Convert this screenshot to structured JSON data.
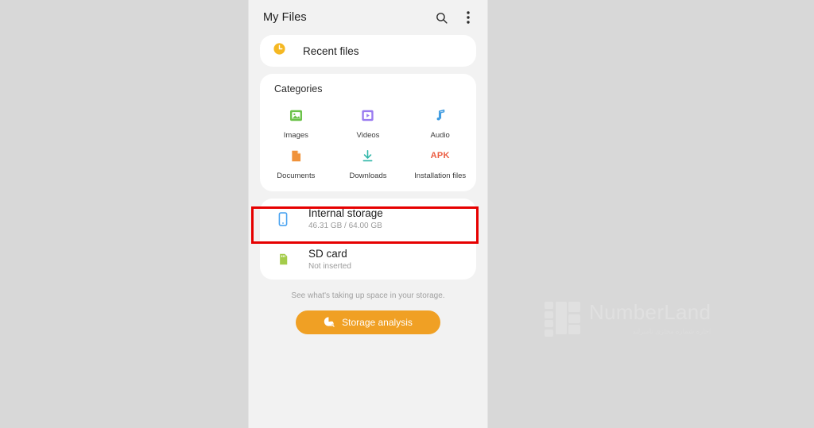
{
  "appbar": {
    "title": "My Files",
    "search_icon": "search-icon",
    "overflow_icon": "more-vertical-icon"
  },
  "recent": {
    "label": "Recent files",
    "icon": "clock-icon",
    "icon_color": "#f5b823"
  },
  "categories": {
    "title": "Categories",
    "items": [
      {
        "label": "Images",
        "icon": "image-icon",
        "color": "#6cc24a"
      },
      {
        "label": "Videos",
        "icon": "video-play-icon",
        "color": "#9a7bf0"
      },
      {
        "label": "Audio",
        "icon": "music-note-icon",
        "color": "#3d9ae0"
      },
      {
        "label": "Documents",
        "icon": "document-icon",
        "color": "#f0923a"
      },
      {
        "label": "Downloads",
        "icon": "download-icon",
        "color": "#2fb6a8"
      },
      {
        "label": "Installation files",
        "icon": "apk-icon",
        "color": "#eb5c41",
        "text": "APK"
      }
    ]
  },
  "storage": {
    "items": [
      {
        "name": "Internal storage",
        "sub": "46.31 GB / 64.00 GB",
        "icon": "phone-storage-icon",
        "color": "#4aa3f0",
        "highlighted": true
      },
      {
        "name": "SD card",
        "sub": "Not inserted",
        "icon": "sd-card-icon",
        "color": "#a4cc4a",
        "highlighted": false
      }
    ],
    "highlight_color": "#e60000"
  },
  "footer": {
    "note": "See what's taking up space in your storage.",
    "button_label": "Storage analysis",
    "button_icon": "storage-analysis-icon",
    "button_color": "#f0a024"
  },
  "watermark": {
    "name": "NumberLand",
    "subtitle": "اجاره شماره مجازی نامبرلند",
    "logo_icon": "numberland-logo-icon"
  }
}
